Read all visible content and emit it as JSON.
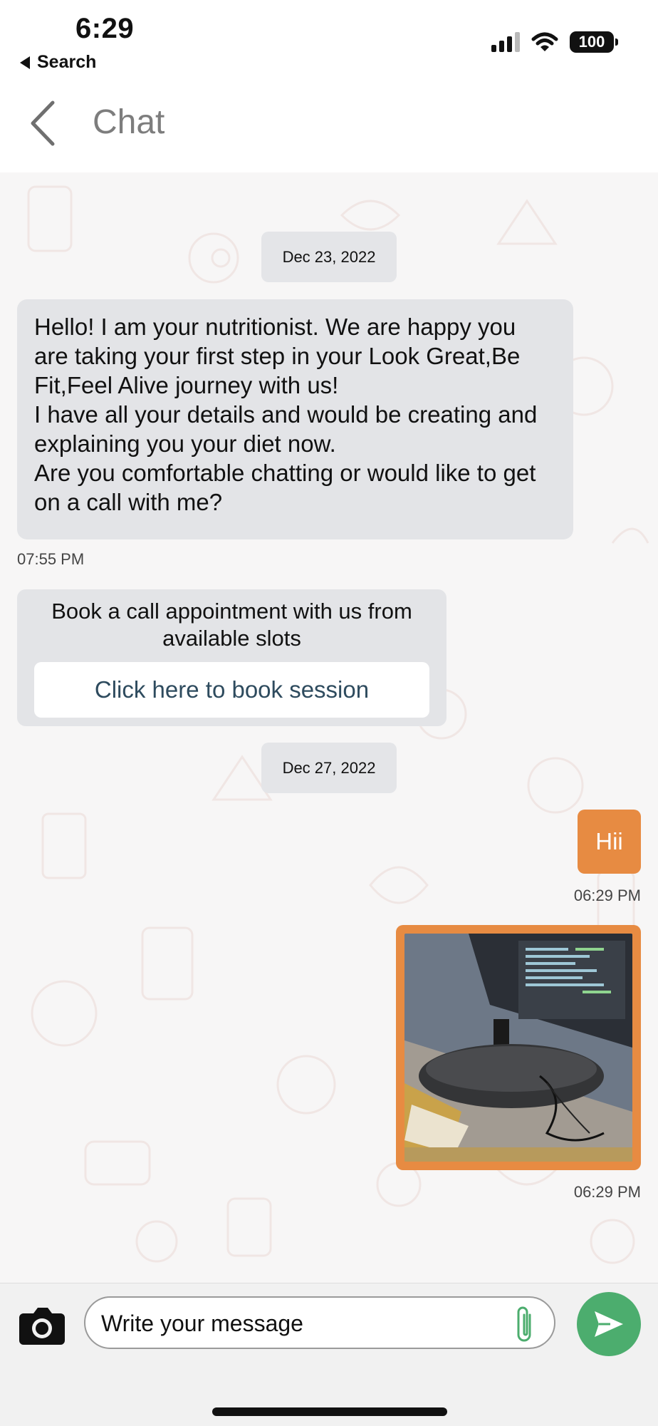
{
  "status_bar": {
    "time": "6:29",
    "back_label": "Search",
    "battery": "100",
    "icons": [
      "signal-icon",
      "wifi-icon",
      "battery-icon"
    ]
  },
  "header": {
    "title": "Chat",
    "back_icon": "chevron-left-icon"
  },
  "chat": {
    "date_1": "Dec 23, 2022",
    "incoming_message": "Hello! I am your nutritionist. We are happy you are taking your first step in your Look Great,Be Fit,Feel Alive journey with us!\nI have all your details and would be creating and explaining you your diet now.\nAre you comfortable chatting or would like to get on a call with me?",
    "incoming_time": "07:55 PM",
    "booking_prompt": "Book a call appointment with us from available slots",
    "booking_button": "Click here to book session",
    "date_2": "Dec 27, 2022",
    "outgoing_message": "Hii",
    "outgoing_time": "06:29 PM",
    "photo_time": "06:29 PM"
  },
  "composer": {
    "placeholder": "Write your message",
    "camera_icon": "camera-icon",
    "attach_icon": "paperclip-icon",
    "send_icon": "send-icon"
  },
  "colors": {
    "outgoing_bubble": "#e78b42",
    "incoming_bubble": "#e3e4e7",
    "send_button": "#4cad6e",
    "book_button_text": "#2e4b5e"
  }
}
